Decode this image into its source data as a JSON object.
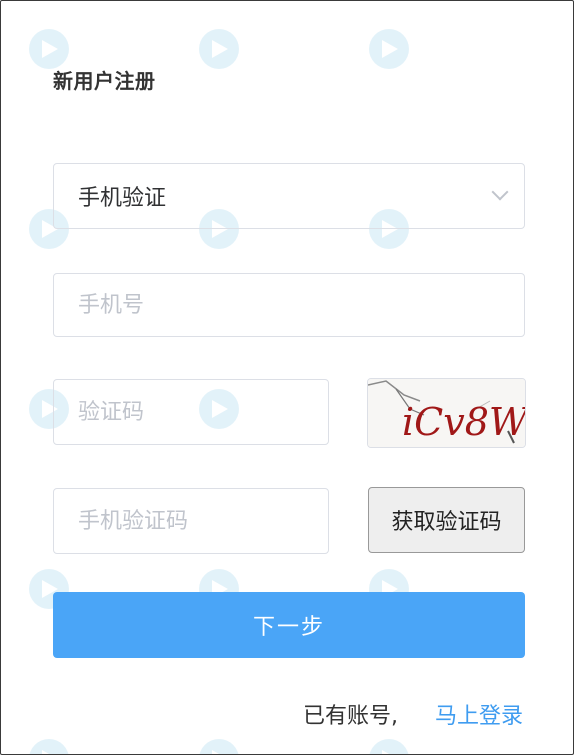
{
  "page": {
    "title": "新用户注册"
  },
  "form": {
    "verify_method": {
      "selected": "手机验证",
      "icon": "chevron-down-icon"
    },
    "phone": {
      "value": "",
      "placeholder": "手机号"
    },
    "captcha": {
      "value": "",
      "placeholder": "验证码",
      "image_text": "iCv8W"
    },
    "sms_code": {
      "value": "",
      "placeholder": "手机验证码"
    },
    "get_code_label": "获取验证码",
    "next_label": "下一步"
  },
  "footer": {
    "have_account": "已有账号,",
    "login_link": "马上登录"
  },
  "colors": {
    "primary": "#4aa5f7",
    "link": "#3f9cf0",
    "border": "#dcdfe6",
    "placeholder": "#c0c4cc"
  }
}
